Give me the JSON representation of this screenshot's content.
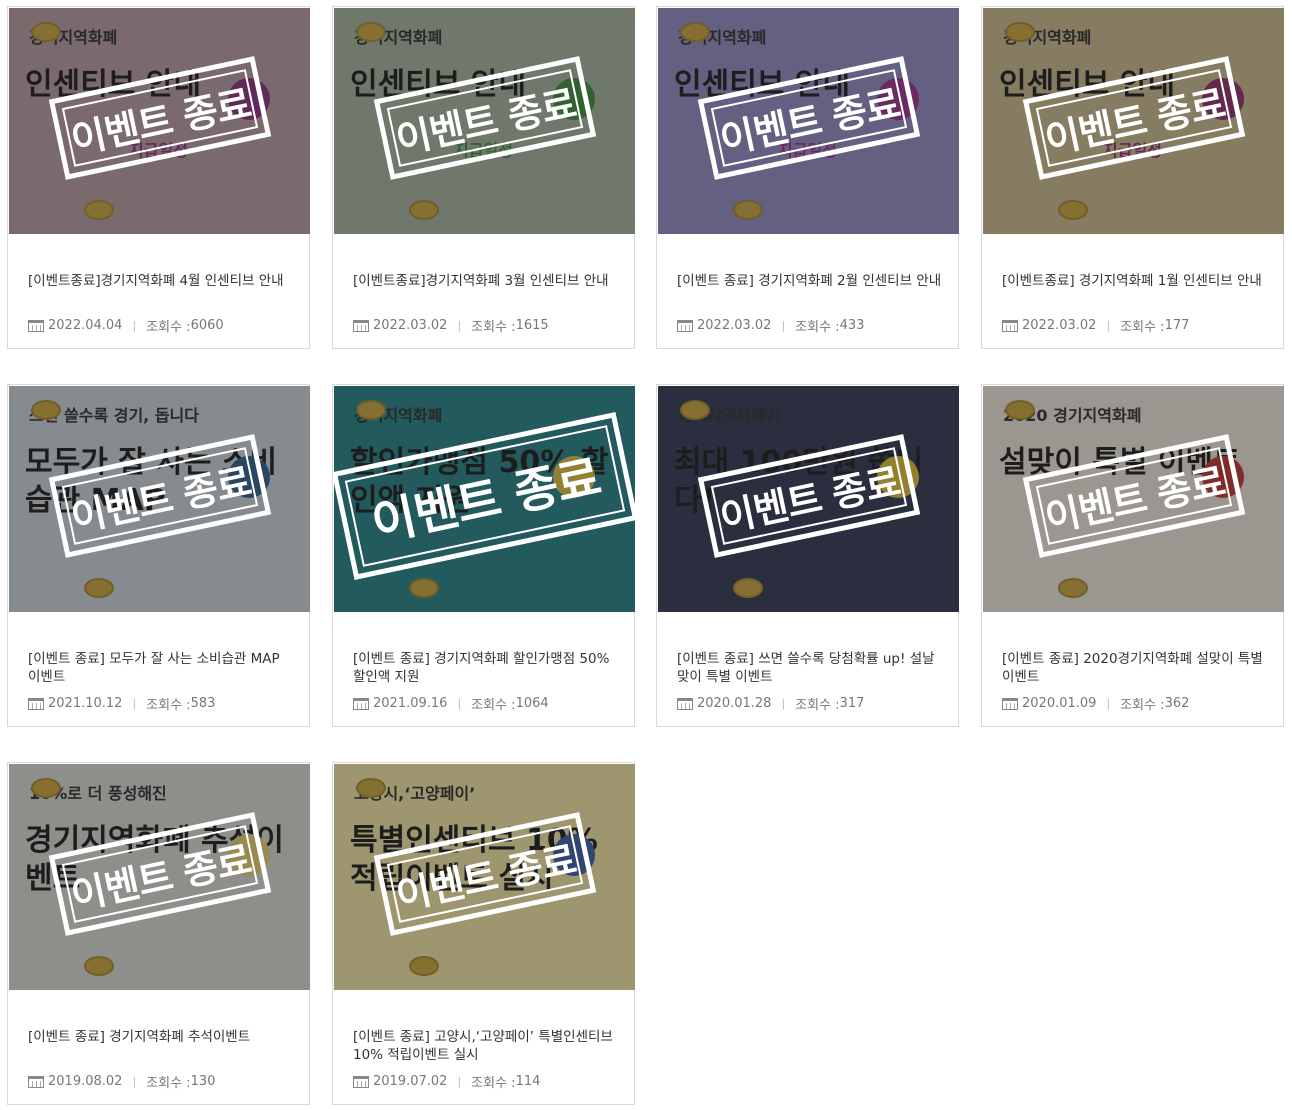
{
  "stamp_label": "이벤트 종료",
  "view_prefix": "조회수 : ",
  "cards": [
    {
      "title": "[이벤트종료]경기지역화폐 4월 인센티브 안내",
      "date": "2022.04.04",
      "views": "6060",
      "thumb": {
        "bg": "#b59aa0",
        "top_text": "경기지역화폐",
        "main_text": "인센티브 안내",
        "sub_text": "지급일정",
        "accent": "#8a2a7a"
      }
    },
    {
      "title": "[이벤트종료]경기지역화폐 3월 인센티브 안내",
      "date": "2022.03.02",
      "views": "1615",
      "thumb": {
        "bg": "#a3b29a",
        "top_text": "경기지역화폐",
        "main_text": "인센티브 안내",
        "sub_text": "지급일정",
        "accent": "#3a8a3a"
      }
    },
    {
      "title": "[이벤트 종료] 경기지역화폐 2월 인센티브 안내",
      "date": "2022.03.02",
      "views": "433",
      "thumb": {
        "bg": "#8e88c2",
        "top_text": "경기지역화폐",
        "main_text": "인센티브 안내",
        "sub_text": "지급일정",
        "accent": "#9a2a8a"
      }
    },
    {
      "title": "[이벤트종료] 경기지역화폐 1월 인센티브 안내",
      "date": "2022.03.02",
      "views": "177",
      "thumb": {
        "bg": "#c9b98a",
        "top_text": "경기지역화폐",
        "main_text": "인센티브 안내",
        "sub_text": "지급일정",
        "accent": "#8a2a6a"
      }
    },
    {
      "title": "[이벤트 종료] 모두가 잘 사는 소비습관 MAP 이벤트",
      "date": "2021.10.12",
      "views": "583",
      "thumb": {
        "bg": "#c9d3d8",
        "top_text": "쓰면 쓸수록 경기, 돕니다",
        "main_text": "모두가 잘 사는 소비습관 MAP",
        "sub_text": "",
        "accent": "#2a5a8a"
      }
    },
    {
      "title": "[이벤트 종료] 경기지역화폐 할인가맹점 50% 할인액 지원",
      "date": "2021.09.16",
      "views": "1064",
      "thumb": {
        "bg": "#1f7f86",
        "top_text": "경기지역화폐",
        "main_text": "할인가맹점 50% 할인액 지원",
        "sub_text": "",
        "accent": "#e0c040"
      }
    },
    {
      "title": "[이벤트 종료] 쓰면 쓸수록 당첨확률 up! 설날맞이 특별 이벤트",
      "date": "2020.01.28",
      "views": "317",
      "thumb": {
        "bg": "#2b3350",
        "top_text": "경기지역화폐가",
        "main_text": "최대 100만원 쏩니다!",
        "sub_text": "",
        "accent": "#e0c030"
      }
    },
    {
      "title": "[이벤트 종료] 2020경기지역화폐 설맞이 특별 이벤트",
      "date": "2020.01.09",
      "views": "362",
      "thumb": {
        "bg": "#efe6dc",
        "top_text": "2020 경기지역화폐",
        "main_text": "설맞이 특별 이벤트",
        "sub_text": "",
        "accent": "#c0302a"
      }
    },
    {
      "title": "[이벤트 종료] 경기지역화폐 추석이벤트",
      "date": "2019.08.02",
      "views": "130",
      "thumb": {
        "bg": "#d8d8d2",
        "top_text": "10%로 더 풍성해진",
        "main_text": "경기지역화폐 추석이벤트",
        "sub_text": "",
        "accent": "#e8d070"
      }
    },
    {
      "title": "[이벤트 종료] 고양시,‘고양페이’ 특별인센티브 10% 적립이벤트 실시",
      "date": "2019.07.02",
      "views": "114",
      "thumb": {
        "bg": "#f2e6a0",
        "top_text": "고양시,‘고양페이’",
        "main_text": "특별인센티브 10%적립이벤트 실시",
        "sub_text": "",
        "accent": "#3a5aa8"
      }
    }
  ]
}
